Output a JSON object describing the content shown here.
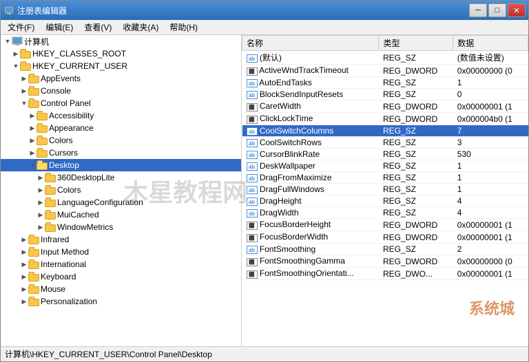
{
  "window": {
    "title": "注册表编辑器",
    "buttons": {
      "minimize": "─",
      "maximize": "□",
      "close": "✕"
    }
  },
  "menu": {
    "items": [
      {
        "label": "文件(F)"
      },
      {
        "label": "编辑(E)"
      },
      {
        "label": "查看(V)"
      },
      {
        "label": "收藏夹(A)"
      },
      {
        "label": "帮助(H)"
      }
    ]
  },
  "tree": {
    "items": [
      {
        "id": "computer",
        "label": "计算机",
        "indent": 0,
        "expanded": true,
        "type": "computer"
      },
      {
        "id": "hkcr",
        "label": "HKEY_CLASSES_ROOT",
        "indent": 1,
        "expanded": false,
        "type": "folder"
      },
      {
        "id": "hkcu",
        "label": "HKEY_CURRENT_USER",
        "indent": 1,
        "expanded": true,
        "type": "folder"
      },
      {
        "id": "appevents",
        "label": "AppEvents",
        "indent": 2,
        "expanded": false,
        "type": "folder"
      },
      {
        "id": "console",
        "label": "Console",
        "indent": 2,
        "expanded": false,
        "type": "folder"
      },
      {
        "id": "controlpanel",
        "label": "Control Panel",
        "indent": 2,
        "expanded": true,
        "type": "folder"
      },
      {
        "id": "accessibility",
        "label": "Accessibility",
        "indent": 3,
        "expanded": false,
        "type": "folder"
      },
      {
        "id": "appearance",
        "label": "Appearance",
        "indent": 3,
        "expanded": false,
        "type": "folder"
      },
      {
        "id": "colors",
        "label": "Colors",
        "indent": 3,
        "expanded": false,
        "type": "folder"
      },
      {
        "id": "cursors",
        "label": "Cursors",
        "indent": 3,
        "expanded": false,
        "type": "folder"
      },
      {
        "id": "desktop",
        "label": "Desktop",
        "indent": 3,
        "expanded": true,
        "type": "folder-open"
      },
      {
        "id": "360desktoplite",
        "label": "360DesktopLite",
        "indent": 4,
        "expanded": false,
        "type": "folder"
      },
      {
        "id": "desktop-colors",
        "label": "Colors",
        "indent": 4,
        "expanded": false,
        "type": "folder"
      },
      {
        "id": "languageconfiguration",
        "label": "LanguageConfiguration",
        "indent": 4,
        "expanded": false,
        "type": "folder"
      },
      {
        "id": "muicached",
        "label": "MuiCached",
        "indent": 4,
        "expanded": false,
        "type": "folder"
      },
      {
        "id": "windowmetrics",
        "label": "WindowMetrics",
        "indent": 4,
        "expanded": false,
        "type": "folder"
      },
      {
        "id": "infrared",
        "label": "Infrared",
        "indent": 2,
        "expanded": false,
        "type": "folder"
      },
      {
        "id": "inputmethod",
        "label": "Input Method",
        "indent": 2,
        "expanded": false,
        "type": "folder"
      },
      {
        "id": "international",
        "label": "International",
        "indent": 2,
        "expanded": false,
        "type": "folder"
      },
      {
        "id": "keyboard",
        "label": "Keyboard",
        "indent": 2,
        "expanded": false,
        "type": "folder"
      },
      {
        "id": "mouse",
        "label": "Mouse",
        "indent": 2,
        "expanded": false,
        "type": "folder"
      },
      {
        "id": "personalization",
        "label": "Personalization",
        "indent": 2,
        "expanded": false,
        "type": "folder"
      }
    ]
  },
  "table": {
    "columns": [
      "名称",
      "类型",
      "数据"
    ],
    "rows": [
      {
        "name": "(默认)",
        "type": "REG_SZ",
        "data": "(数值未设置)",
        "selected": false,
        "icon": "ab"
      },
      {
        "name": "ActiveWndTrackTimeout",
        "type": "REG_DWORD",
        "data": "0x00000000 (0",
        "selected": false,
        "icon": "dword"
      },
      {
        "name": "AutoEndTasks",
        "type": "REG_SZ",
        "data": "1",
        "selected": false,
        "icon": "ab"
      },
      {
        "name": "BlockSendInputResets",
        "type": "REG_SZ",
        "data": "0",
        "selected": false,
        "icon": "ab"
      },
      {
        "name": "CaretWidth",
        "type": "REG_DWORD",
        "data": "0x00000001 (1",
        "selected": false,
        "icon": "dword"
      },
      {
        "name": "ClickLockTime",
        "type": "REG_DWORD",
        "data": "0x000004b0 (1",
        "selected": false,
        "icon": "dword"
      },
      {
        "name": "CoolSwitchColumns",
        "type": "REG_SZ",
        "data": "7",
        "selected": true,
        "icon": "ab"
      },
      {
        "name": "CoolSwitchRows",
        "type": "REG_SZ",
        "data": "3",
        "selected": false,
        "icon": "ab"
      },
      {
        "name": "CursorBlinkRate",
        "type": "REG_SZ",
        "data": "530",
        "selected": false,
        "icon": "ab"
      },
      {
        "name": "DeskWallpaper",
        "type": "REG_SZ",
        "data": "1",
        "selected": false,
        "icon": "ab"
      },
      {
        "name": "DragFromMaximize",
        "type": "REG_SZ",
        "data": "1",
        "selected": false,
        "icon": "ab"
      },
      {
        "name": "DragFullWindows",
        "type": "REG_SZ",
        "data": "1",
        "selected": false,
        "icon": "ab"
      },
      {
        "name": "DragHeight",
        "type": "REG_SZ",
        "data": "4",
        "selected": false,
        "icon": "ab"
      },
      {
        "name": "DragWidth",
        "type": "REG_SZ",
        "data": "4",
        "selected": false,
        "icon": "ab"
      },
      {
        "name": "FocusBorderHeight",
        "type": "REG_DWORD",
        "data": "0x00000001 (1",
        "selected": false,
        "icon": "dword"
      },
      {
        "name": "FocusBorderWidth",
        "type": "REG_DWORD",
        "data": "0x00000001 (1",
        "selected": false,
        "icon": "dword"
      },
      {
        "name": "FontSmoothing",
        "type": "REG_SZ",
        "data": "2",
        "selected": false,
        "icon": "ab"
      },
      {
        "name": "FontSmoothingGamma",
        "type": "REG_DWORD",
        "data": "0x00000000 (0",
        "selected": false,
        "icon": "dword"
      },
      {
        "name": "FontSmoothingOrientati...",
        "type": "REG_DWO...",
        "data": "0x00000001 (1",
        "selected": false,
        "icon": "dword"
      }
    ]
  },
  "status_bar": {
    "text": "计算机\\HKEY_CURRENT_USER\\Control Panel\\Desktop"
  },
  "watermark": {
    "text": "木星教程网",
    "text2": "系统城"
  }
}
